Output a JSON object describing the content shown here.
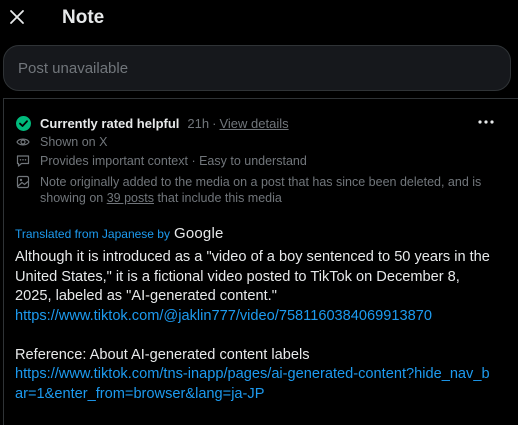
{
  "header": {
    "close_icon": "close-icon",
    "title": "Note"
  },
  "post": {
    "unavailable_text": "Post unavailable"
  },
  "note": {
    "rating_status": "Currently rated helpful",
    "age": "21h",
    "separator": "·",
    "details_link": "View details",
    "more_icon": "more-horizontal-icon",
    "shown_on": "Shown on X",
    "context": "Provides important context · Easy to understand",
    "media_note_prefix": "Note originally added to the media on a post that has since been deleted, and is showing on ",
    "posts_link": "39 posts",
    "media_note_suffix": " that include this media",
    "translated_from": "Translated from Japanese by",
    "translator": "Google",
    "body_text": "Although it is introduced as a \"video of a boy sentenced to 50 years in the United States,\" it is a fictional video posted to TikTok on December 8, 2025, labeled as \"AI-generated content.\"",
    "link_1": "https://www.tiktok.com/@jaklin777/video/7581160384069913870",
    "reference_text": "Reference: About AI-generated content labels",
    "link_2": "https://www.tiktok.com/tns-inapp/pages/ai-generated-content?hide_nav_bar=1&enter_from=browser&lang=ja-JP"
  },
  "colors": {
    "background": "#000000",
    "text": "#e7e9ea",
    "muted": "#71767b",
    "link": "#1d9bf0",
    "helpful_green": "#00ba7c",
    "border": "#2f3336"
  }
}
